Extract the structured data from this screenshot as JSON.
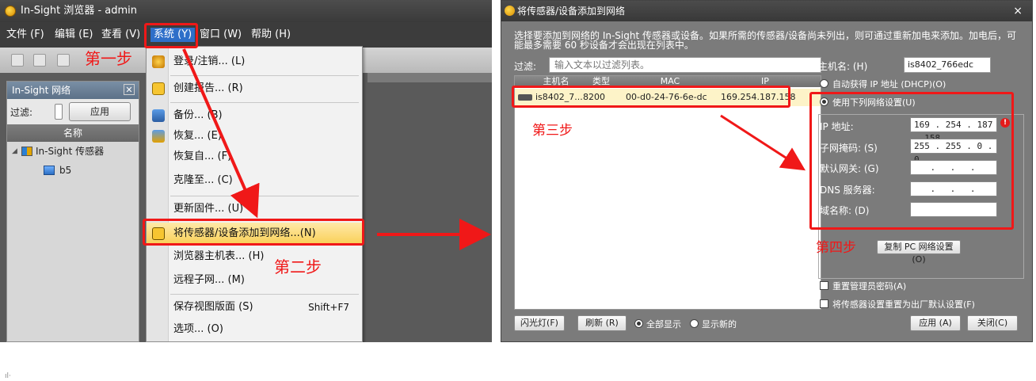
{
  "browser": {
    "title": "In-Sight 浏览器 - admin",
    "menu": [
      "文件 (F)",
      "编辑 (E)",
      "查看 (V)",
      "系统 (Y)",
      "窗口 (W)",
      "帮助 (H)"
    ],
    "network_panel": {
      "title": "In-Sight 网络",
      "filter_label": "过滤:",
      "apply_label": "应用",
      "column_name": "名称",
      "tree": {
        "group": "In-Sight 传感器",
        "device": "b5"
      }
    },
    "system_menu": {
      "items": [
        "登录/注销... (L)",
        "创建报告... (R)",
        "备份... (B)",
        "恢复... (E)",
        "恢复自... (F)",
        "克隆至... (C)",
        "更新固件... (U)",
        "将传感器/设备添加到网络...(N)",
        "浏览器主机表... (H)",
        "远程子网... (M)",
        "保存视图版面 (S)",
        "选项... (O)"
      ],
      "shortcut_save_layout": "Shift+F7"
    }
  },
  "dialog": {
    "title": "将传感器/设备添加到网络",
    "close": "×",
    "instructions_line1": "选择要添加到网络的 In-Sight 传感器或设备。如果所需的传感器/设备尚未列出，则可通过重新加电来添加。加电后，可",
    "instructions_line2": "能最多需要 60 秒设备才会出现在列表中。",
    "filter_label": "过滤:",
    "filter_placeholder": "输入文本以过滤列表。",
    "table": {
      "headers": [
        "主机名",
        "类型",
        "MAC",
        "IP"
      ],
      "rows": [
        {
          "host": "is8402_7...",
          "type": "8200",
          "mac": "00-d0-24-76-6e-dc",
          "ip": "169.254.187.158"
        }
      ]
    },
    "hostname_label": "主机名: (H)",
    "hostname_value": "is8402_766edc",
    "dhcp_label": "自动获得 IP 地址 (DHCP)(O)",
    "manual_label": "使用下列网络设置(U)",
    "ip_label": "IP 地址:",
    "ip_value": "169 . 254 . 187 . 158",
    "subnet_label": "子网掩码: (S)",
    "subnet_value": "255 . 255 . 0 . 0",
    "gateway_label": "默认网关: (G)",
    "gateway_value": ". . .",
    "dns_label": "DNS 服务器:",
    "dns_value": ". . .",
    "domain_label": "域名称: (D)",
    "copy_pc_label": "复制 PC 网络设置(O)",
    "reset_admin_label": "重置管理员密码(A)",
    "factory_reset_label": "将传感器设置重置为出厂默认设置(F)",
    "flash_button": "闪光灯(F)",
    "refresh_button": "刷新 (R)",
    "show_all_label": "全部显示",
    "show_new_label": "显示新的",
    "apply_button": "应用 (A)",
    "close_button": "关闭(C)"
  },
  "annotations": {
    "step1": "第一步",
    "step2": "第二步",
    "step3": "第三步",
    "step4": "第四步",
    "color": "#f01818"
  },
  "footer_mark": "ıl·"
}
